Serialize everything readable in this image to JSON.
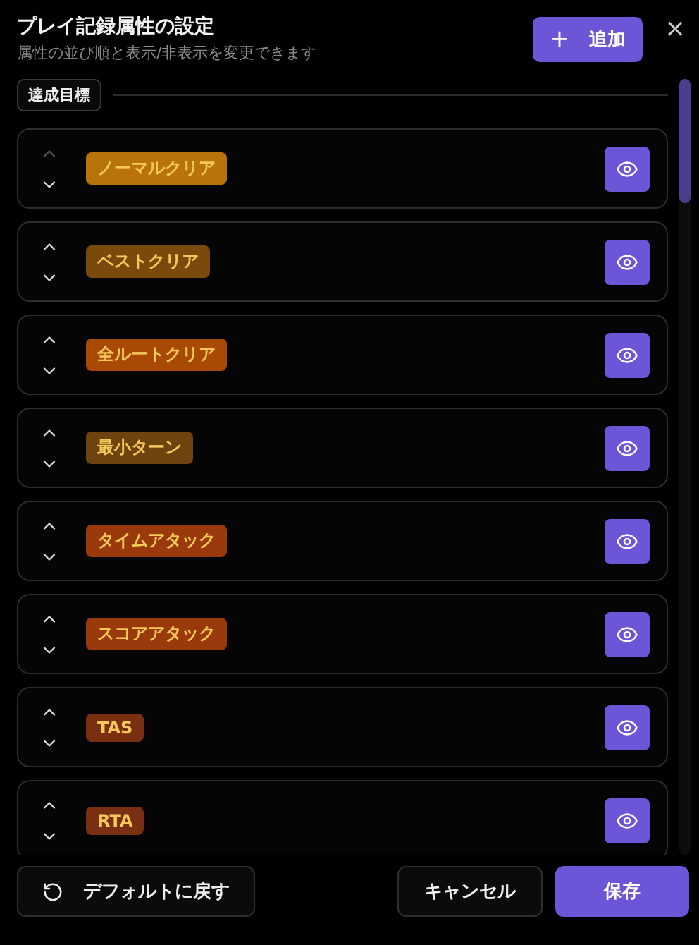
{
  "dialog": {
    "title": "プレイ記録属性の設定",
    "subtitle": "属性の並び順と表示/非表示を変更できます",
    "add_button": {
      "icon": "+",
      "label": "追加"
    },
    "close": "×"
  },
  "section": {
    "label": "達成目標"
  },
  "attributes": [
    {
      "label": "ノーマルクリア",
      "color": "#b8730a",
      "up_disabled": true,
      "visible": true
    },
    {
      "label": "ベストクリア",
      "color": "#7a4a0c",
      "up_disabled": false,
      "visible": true
    },
    {
      "label": "全ルートクリア",
      "color": "#a84a06",
      "up_disabled": false,
      "visible": true
    },
    {
      "label": "最小ターン",
      "color": "#6e440e",
      "up_disabled": false,
      "visible": true
    },
    {
      "label": "タイムアタック",
      "color": "#9a3a0c",
      "up_disabled": false,
      "visible": true
    },
    {
      "label": "スコアアタック",
      "color": "#9a3a0c",
      "up_disabled": false,
      "visible": true
    },
    {
      "label": "TAS",
      "color": "#7a2e12",
      "up_disabled": false,
      "visible": true
    },
    {
      "label": "RTA",
      "color": "#7a2e12",
      "up_disabled": false,
      "visible": true
    }
  ],
  "footer": {
    "reset": "デフォルトに戻す",
    "cancel": "キャンセル",
    "save": "保存"
  }
}
